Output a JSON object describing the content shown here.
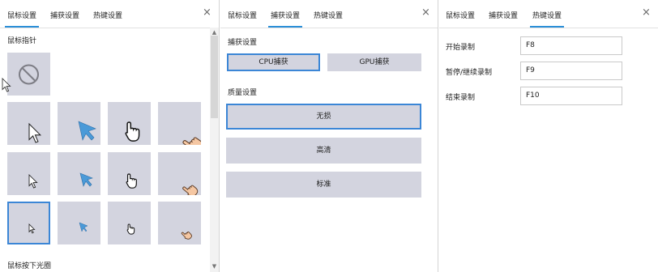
{
  "colors": {
    "accent": "#2b8fd8",
    "tile_bg": "#d3d4df",
    "selected_border": "#3b86d6"
  },
  "tabs": [
    "鼠标设置",
    "捕获设置",
    "热键设置"
  ],
  "close_icon": "×",
  "mouse_panel": {
    "section_pointer": "鼠标指针",
    "section_press": "鼠标按下光圈",
    "cursor_tiles": [
      {
        "icon": "no-cursor-icon"
      },
      {
        "icon": "arrow-white-large-icon"
      },
      {
        "icon": "arrow-blue-large-icon"
      },
      {
        "icon": "hand-white-large-icon"
      },
      {
        "icon": "hand-skin-large-icon"
      },
      {
        "icon": "arrow-white-medium-icon"
      },
      {
        "icon": "arrow-blue-medium-icon"
      },
      {
        "icon": "hand-white-medium-icon"
      },
      {
        "icon": "hand-skin-medium-icon"
      },
      {
        "icon": "arrow-white-small-icon",
        "selected": true
      },
      {
        "icon": "arrow-blue-small-icon"
      },
      {
        "icon": "hand-white-small-icon"
      },
      {
        "icon": "hand-skin-small-icon"
      }
    ]
  },
  "capture_panel": {
    "section_capture": "捕获设置",
    "cpu_label": "CPU捕获",
    "gpu_label": "GPU捕获",
    "section_quality": "质量设置",
    "quality_options": [
      "无损",
      "高清",
      "标准"
    ]
  },
  "hotkey_panel": {
    "rows": [
      {
        "label": "开始录制",
        "value": "F8"
      },
      {
        "label": "暂停/继续录制",
        "value": "F9"
      },
      {
        "label": "结束录制",
        "value": "F10"
      }
    ]
  }
}
